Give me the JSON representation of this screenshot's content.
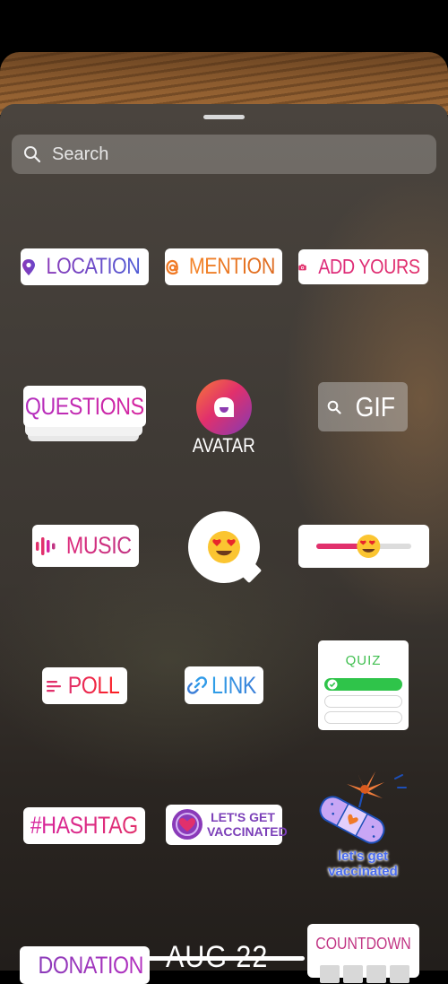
{
  "search": {
    "placeholder": "Search"
  },
  "stickers": {
    "location": "LOCATION",
    "mention": "MENTION",
    "add_yours": "ADD YOURS",
    "questions": "QUESTIONS",
    "avatar": "AVATAR",
    "gif": "GIF",
    "music": "MUSIC",
    "poll": "POLL",
    "link": "LINK",
    "quiz": "QUIZ",
    "hashtag": "#HASHTAG",
    "vaccinated_line1": "LET'S GET",
    "vaccinated_line2": "VACCINATED",
    "vaccinated_art_line1": "let's get",
    "vaccinated_art_line2": "vaccinated",
    "donation": "DONATION",
    "date": "AUG 22",
    "countdown": "COUNTDOWN"
  },
  "slider": {
    "value_fraction": 0.55
  },
  "colors": {
    "location": "#6a45c9",
    "mention": "#f07a25",
    "add_yours": "#e1306c",
    "quiz_green": "#3fbf4f",
    "link": "#2f9ae8"
  },
  "icons": {
    "search": "search-icon",
    "location": "location-pin-icon",
    "mention": "threads-at-icon",
    "add_yours": "camera-icon",
    "music": "music-bars-icon",
    "poll": "poll-lines-icon",
    "link": "link-chain-icon",
    "donation": "heart-icon"
  }
}
